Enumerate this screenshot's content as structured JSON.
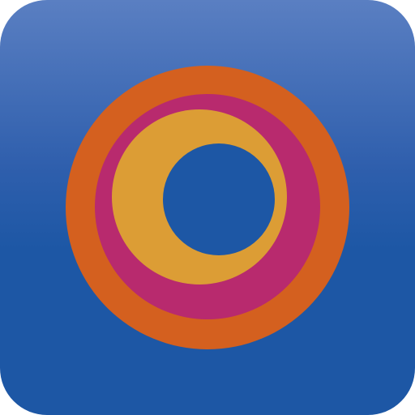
{
  "icon": {
    "name": "concentric-rings-app-icon",
    "colors": {
      "background_top": "#5a7fc2",
      "background_bottom": "#1d57a5",
      "outer_ring": "#d4601f",
      "middle_ring": "#b82a6e",
      "inner_ring": "#dc9d35",
      "center_hole": "#1d57a5"
    }
  }
}
